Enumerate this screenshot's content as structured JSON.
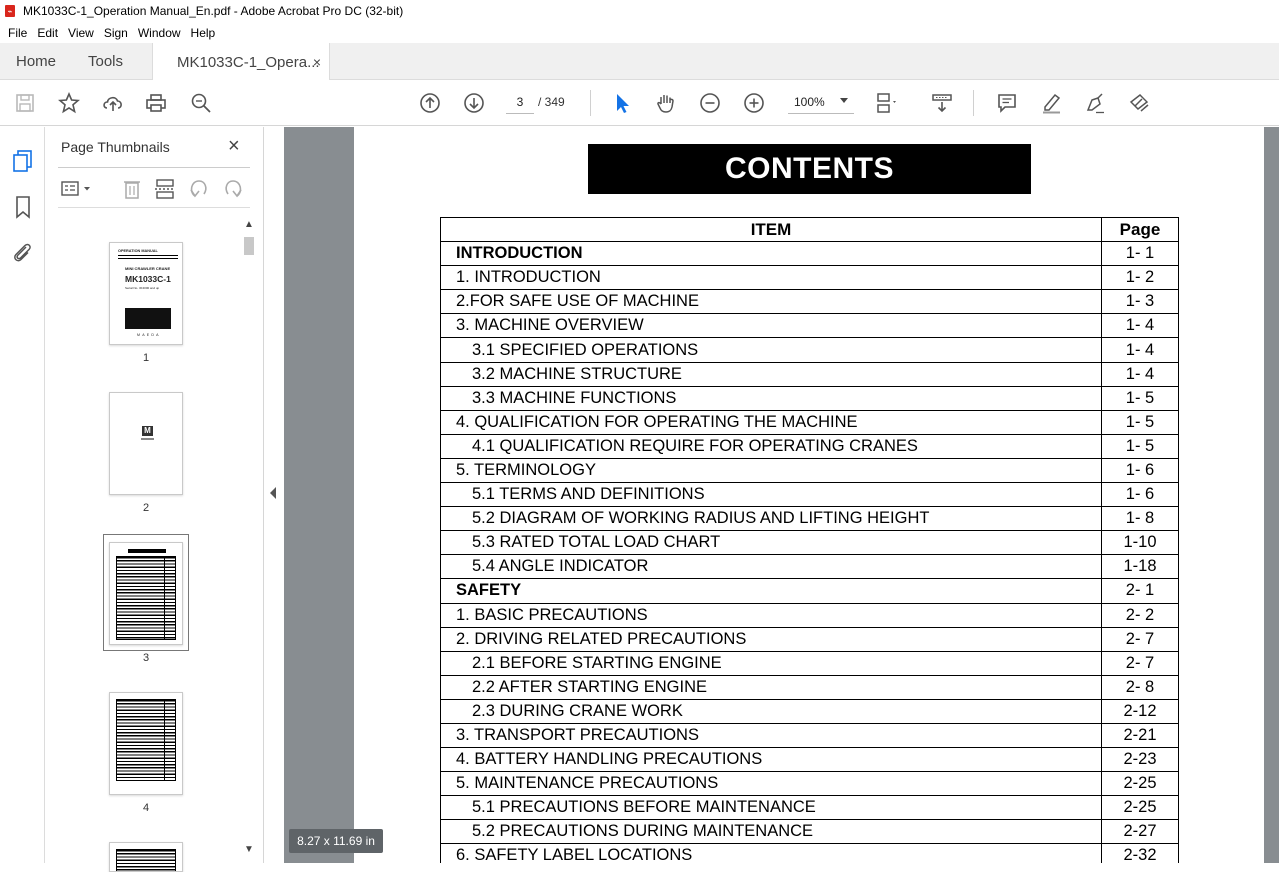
{
  "window": {
    "title": "MK1033C-1_Operation Manual_En.pdf - Adobe Acrobat Pro DC (32-bit)"
  },
  "menu": [
    "File",
    "Edit",
    "View",
    "Sign",
    "Window",
    "Help"
  ],
  "tabs": {
    "home": "Home",
    "tools": "Tools",
    "document": "MK1033C-1_Opera...",
    "close": "×"
  },
  "toolbar": {
    "current_page": "3",
    "total_pages": "/ 349",
    "zoom": "100%"
  },
  "panel": {
    "title": "Page Thumbnails",
    "close": "×",
    "thumbnails": [
      {
        "num": "1"
      },
      {
        "num": "2"
      },
      {
        "num": "3"
      },
      {
        "num": "4"
      }
    ],
    "thumb1": {
      "header": "OPERATION MANUAL",
      "subtitle": "MINI CRAWLER CRANE",
      "model": "MK1033C-1",
      "serial": "Serial No. 3F4000 and up",
      "brand": "MAEDA"
    },
    "thumb2": {
      "logo": "M"
    }
  },
  "document": {
    "heading": "CONTENTS",
    "columns": {
      "item": "ITEM",
      "page": "Page"
    },
    "rows": [
      {
        "item": "INTRODUCTION",
        "page": "1- 1",
        "level": "section"
      },
      {
        "item": "1. INTRODUCTION",
        "page": "1- 2",
        "level": "top"
      },
      {
        "item": "2.FOR SAFE USE OF MACHINE",
        "page": "1- 3",
        "level": "top"
      },
      {
        "item": "3. MACHINE OVERVIEW",
        "page": "1- 4",
        "level": "top"
      },
      {
        "item": "3.1 SPECIFIED OPERATIONS",
        "page": "1- 4",
        "level": "sub"
      },
      {
        "item": "3.2 MACHINE STRUCTURE",
        "page": "1- 4",
        "level": "sub"
      },
      {
        "item": "3.3 MACHINE FUNCTIONS",
        "page": "1- 5",
        "level": "sub"
      },
      {
        "item": "4. QUALIFICATION FOR OPERATING THE MACHINE",
        "page": "1- 5",
        "level": "top"
      },
      {
        "item": "4.1 QUALIFICATION REQUIRE FOR OPERATING CRANES",
        "page": "1- 5",
        "level": "sub"
      },
      {
        "item": "5. TERMINOLOGY",
        "page": "1- 6",
        "level": "top"
      },
      {
        "item": "5.1 TERMS AND DEFINITIONS",
        "page": "1- 6",
        "level": "sub"
      },
      {
        "item": "5.2 DIAGRAM OF WORKING RADIUS AND LIFTING HEIGHT",
        "page": "1- 8",
        "level": "sub"
      },
      {
        "item": "5.3 RATED TOTAL LOAD CHART",
        "page": "1-10",
        "level": "sub"
      },
      {
        "item": "5.4 ANGLE INDICATOR",
        "page": "1-18",
        "level": "sub"
      },
      {
        "item": "SAFETY",
        "page": "2- 1",
        "level": "section"
      },
      {
        "item": "1. BASIC PRECAUTIONS",
        "page": "2- 2",
        "level": "top"
      },
      {
        "item": "2. DRIVING RELATED PRECAUTIONS",
        "page": "2- 7",
        "level": "top"
      },
      {
        "item": "2.1 BEFORE STARTING ENGINE",
        "page": "2- 7",
        "level": "sub"
      },
      {
        "item": "2.2 AFTER STARTING ENGINE",
        "page": "2- 8",
        "level": "sub"
      },
      {
        "item": "2.3 DURING CRANE WORK",
        "page": "2-12",
        "level": "sub"
      },
      {
        "item": "3. TRANSPORT PRECAUTIONS",
        "page": "2-21",
        "level": "top"
      },
      {
        "item": "4. BATTERY HANDLING PRECAUTIONS",
        "page": "2-23",
        "level": "top"
      },
      {
        "item": "5. MAINTENANCE PRECAUTIONS",
        "page": "2-25",
        "level": "top"
      },
      {
        "item": "5.1 PRECAUTIONS BEFORE MAINTENANCE",
        "page": "2-25",
        "level": "sub"
      },
      {
        "item": "5.2 PRECAUTIONS DURING MAINTENANCE",
        "page": "2-27",
        "level": "sub"
      },
      {
        "item": "6. SAFETY LABEL LOCATIONS",
        "page": "2-32",
        "level": "top"
      }
    ]
  },
  "status": {
    "page_size": "8.27 x 11.69 in"
  }
}
